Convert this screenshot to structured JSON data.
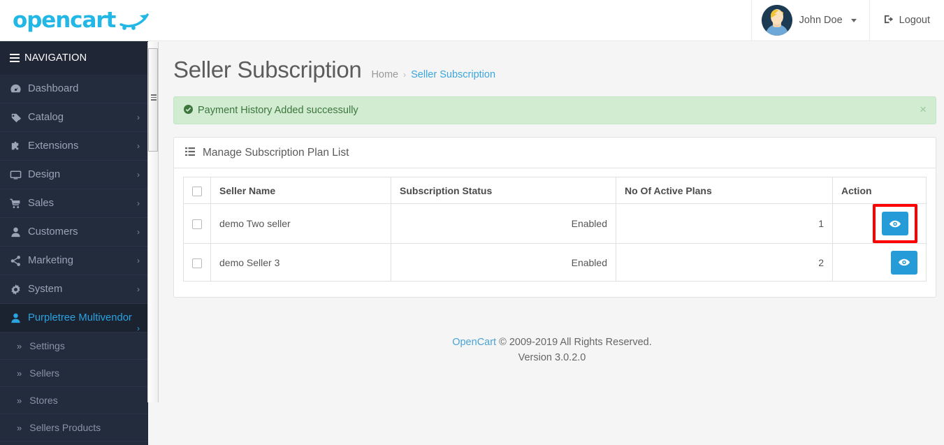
{
  "brand": {
    "logo_text": "opencart",
    "logo_color": "#23b7e5"
  },
  "header": {
    "user_name": "John Doe",
    "logout_label": "Logout",
    "avatar_icon": "user-avatar-image",
    "caret_icon": "caret-down-icon",
    "logout_icon": "logout-icon"
  },
  "sidebar": {
    "nav_label": "NAVIGATION",
    "items": [
      {
        "label": "Dashboard",
        "icon": "dashboard-icon",
        "chevron": "",
        "active": false
      },
      {
        "label": "Catalog",
        "icon": "tag-icon",
        "chevron": "›",
        "active": false
      },
      {
        "label": "Extensions",
        "icon": "puzzle-icon",
        "chevron": "›",
        "active": false
      },
      {
        "label": "Design",
        "icon": "monitor-icon",
        "chevron": "›",
        "active": false
      },
      {
        "label": "Sales",
        "icon": "cart-icon",
        "chevron": "›",
        "active": false
      },
      {
        "label": "Customers",
        "icon": "user-icon",
        "chevron": "›",
        "active": false
      },
      {
        "label": "Marketing",
        "icon": "share-icon",
        "chevron": "›",
        "active": false
      },
      {
        "label": "System",
        "icon": "gear-icon",
        "chevron": "›",
        "active": false
      },
      {
        "label": "Purpletree Multivendor",
        "icon": "user-icon",
        "chevron": "›",
        "active": true
      }
    ],
    "sub_items": [
      {
        "label": "Settings",
        "icon": "angle-double-right-icon"
      },
      {
        "label": "Sellers",
        "icon": "angle-double-right-icon"
      },
      {
        "label": "Stores",
        "icon": "angle-double-right-icon"
      },
      {
        "label": "Sellers Products",
        "icon": "angle-double-right-icon"
      }
    ],
    "scrollbar": {
      "name": "sidebar-scrollbar",
      "grip_icon": "scrollbar-grip-icon"
    }
  },
  "page": {
    "title": "Seller Subscription",
    "breadcrumb": [
      {
        "label": "Home",
        "link": false
      },
      {
        "label": "Seller Subscription",
        "link": true
      }
    ],
    "breadcrumb_separator": "›"
  },
  "alert": {
    "message": "Payment History Added successully",
    "check_icon": "check-circle-icon",
    "close_icon": "close-icon",
    "close_label": "×",
    "bg_color": "#d2ecd2",
    "text_color": "#3c763d"
  },
  "panel": {
    "title": "Manage Subscription Plan List",
    "icon": "list-icon"
  },
  "table": {
    "columns": [
      "",
      "Seller Name",
      "Subscription Status",
      "No Of Active Plans",
      "Action"
    ],
    "rows": [
      {
        "selected": false,
        "seller_name": "demo Two seller",
        "subscription_status": "Enabled",
        "active_plans": "1",
        "action_icon": "eye-icon",
        "highlighted": true
      },
      {
        "selected": false,
        "seller_name": "demo Seller 3",
        "subscription_status": "Enabled",
        "active_plans": "2",
        "action_icon": "eye-icon",
        "highlighted": false
      }
    ],
    "accent_color": "#259cd8",
    "highlight_color": "#fe0000"
  },
  "footer": {
    "link_label": "OpenCart",
    "copyright": "© 2009-2019 All Rights Reserved.",
    "version": "Version 3.0.2.0"
  }
}
